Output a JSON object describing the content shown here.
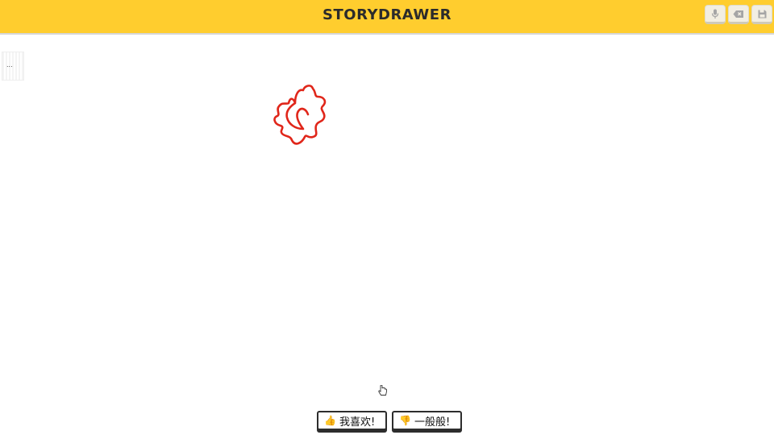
{
  "header": {
    "logo": "STORYDRAWER",
    "tools": [
      {
        "name": "mic",
        "icon": "microphone-icon"
      },
      {
        "name": "eraser",
        "icon": "eraser-icon"
      },
      {
        "name": "save",
        "icon": "save-icon"
      }
    ]
  },
  "sidebar": {
    "thumbnail_label": "..."
  },
  "canvas": {
    "stroke_color": "#e0261a"
  },
  "feedback": {
    "like_emoji": "👍",
    "like_label": "我喜欢!",
    "meh_emoji": "👎",
    "meh_label": "一般般!"
  },
  "colors": {
    "header_bg": "#ffcd2e",
    "stroke": "#e0261a"
  }
}
